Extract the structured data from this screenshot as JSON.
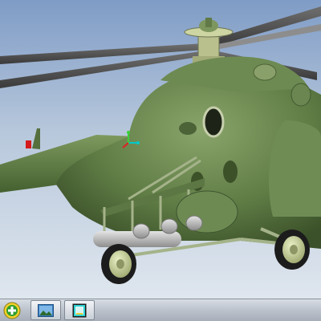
{
  "app": {
    "window_title": "",
    "viewport_label": ""
  },
  "scene": {
    "model": "helicopter",
    "background_top": "#7f9cc6",
    "background_bottom": "#dfe6ee",
    "body_color": "#5e7a45",
    "tire_color": "#1c1c1c",
    "hub_color": "#c9d39b"
  },
  "taskbar": {
    "buttons": [
      {
        "name": "add",
        "icon": "green-plus-icon"
      },
      {
        "name": "view",
        "icon": "picture-icon"
      },
      {
        "name": "display",
        "icon": "cyan-square-icon"
      }
    ]
  }
}
